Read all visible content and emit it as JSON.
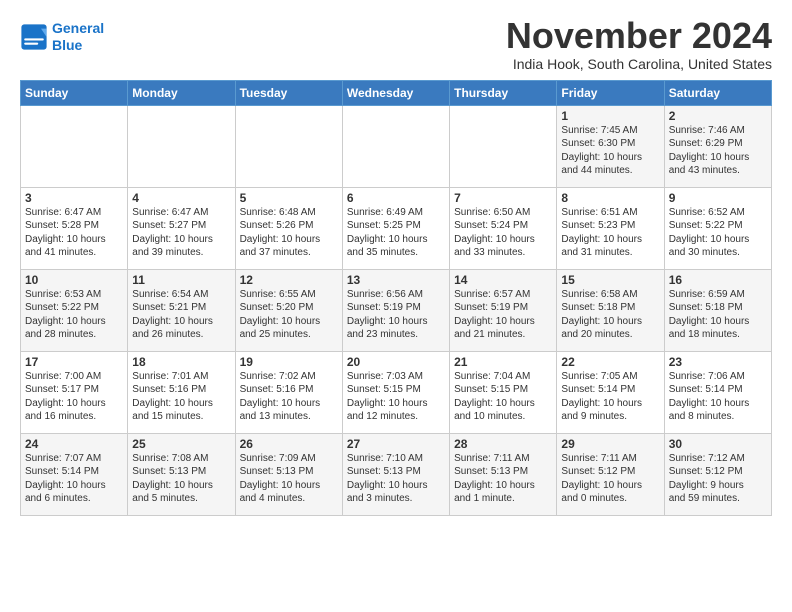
{
  "logo": {
    "line1": "General",
    "line2": "Blue"
  },
  "title": "November 2024",
  "subtitle": "India Hook, South Carolina, United States",
  "weekdays": [
    "Sunday",
    "Monday",
    "Tuesday",
    "Wednesday",
    "Thursday",
    "Friday",
    "Saturday"
  ],
  "weeks": [
    [
      {
        "day": "",
        "info": ""
      },
      {
        "day": "",
        "info": ""
      },
      {
        "day": "",
        "info": ""
      },
      {
        "day": "",
        "info": ""
      },
      {
        "day": "",
        "info": ""
      },
      {
        "day": "1",
        "info": "Sunrise: 7:45 AM\nSunset: 6:30 PM\nDaylight: 10 hours\nand 44 minutes."
      },
      {
        "day": "2",
        "info": "Sunrise: 7:46 AM\nSunset: 6:29 PM\nDaylight: 10 hours\nand 43 minutes."
      }
    ],
    [
      {
        "day": "3",
        "info": "Sunrise: 6:47 AM\nSunset: 5:28 PM\nDaylight: 10 hours\nand 41 minutes."
      },
      {
        "day": "4",
        "info": "Sunrise: 6:47 AM\nSunset: 5:27 PM\nDaylight: 10 hours\nand 39 minutes."
      },
      {
        "day": "5",
        "info": "Sunrise: 6:48 AM\nSunset: 5:26 PM\nDaylight: 10 hours\nand 37 minutes."
      },
      {
        "day": "6",
        "info": "Sunrise: 6:49 AM\nSunset: 5:25 PM\nDaylight: 10 hours\nand 35 minutes."
      },
      {
        "day": "7",
        "info": "Sunrise: 6:50 AM\nSunset: 5:24 PM\nDaylight: 10 hours\nand 33 minutes."
      },
      {
        "day": "8",
        "info": "Sunrise: 6:51 AM\nSunset: 5:23 PM\nDaylight: 10 hours\nand 31 minutes."
      },
      {
        "day": "9",
        "info": "Sunrise: 6:52 AM\nSunset: 5:22 PM\nDaylight: 10 hours\nand 30 minutes."
      }
    ],
    [
      {
        "day": "10",
        "info": "Sunrise: 6:53 AM\nSunset: 5:22 PM\nDaylight: 10 hours\nand 28 minutes."
      },
      {
        "day": "11",
        "info": "Sunrise: 6:54 AM\nSunset: 5:21 PM\nDaylight: 10 hours\nand 26 minutes."
      },
      {
        "day": "12",
        "info": "Sunrise: 6:55 AM\nSunset: 5:20 PM\nDaylight: 10 hours\nand 25 minutes."
      },
      {
        "day": "13",
        "info": "Sunrise: 6:56 AM\nSunset: 5:19 PM\nDaylight: 10 hours\nand 23 minutes."
      },
      {
        "day": "14",
        "info": "Sunrise: 6:57 AM\nSunset: 5:19 PM\nDaylight: 10 hours\nand 21 minutes."
      },
      {
        "day": "15",
        "info": "Sunrise: 6:58 AM\nSunset: 5:18 PM\nDaylight: 10 hours\nand 20 minutes."
      },
      {
        "day": "16",
        "info": "Sunrise: 6:59 AM\nSunset: 5:18 PM\nDaylight: 10 hours\nand 18 minutes."
      }
    ],
    [
      {
        "day": "17",
        "info": "Sunrise: 7:00 AM\nSunset: 5:17 PM\nDaylight: 10 hours\nand 16 minutes."
      },
      {
        "day": "18",
        "info": "Sunrise: 7:01 AM\nSunset: 5:16 PM\nDaylight: 10 hours\nand 15 minutes."
      },
      {
        "day": "19",
        "info": "Sunrise: 7:02 AM\nSunset: 5:16 PM\nDaylight: 10 hours\nand 13 minutes."
      },
      {
        "day": "20",
        "info": "Sunrise: 7:03 AM\nSunset: 5:15 PM\nDaylight: 10 hours\nand 12 minutes."
      },
      {
        "day": "21",
        "info": "Sunrise: 7:04 AM\nSunset: 5:15 PM\nDaylight: 10 hours\nand 10 minutes."
      },
      {
        "day": "22",
        "info": "Sunrise: 7:05 AM\nSunset: 5:14 PM\nDaylight: 10 hours\nand 9 minutes."
      },
      {
        "day": "23",
        "info": "Sunrise: 7:06 AM\nSunset: 5:14 PM\nDaylight: 10 hours\nand 8 minutes."
      }
    ],
    [
      {
        "day": "24",
        "info": "Sunrise: 7:07 AM\nSunset: 5:14 PM\nDaylight: 10 hours\nand 6 minutes."
      },
      {
        "day": "25",
        "info": "Sunrise: 7:08 AM\nSunset: 5:13 PM\nDaylight: 10 hours\nand 5 minutes."
      },
      {
        "day": "26",
        "info": "Sunrise: 7:09 AM\nSunset: 5:13 PM\nDaylight: 10 hours\nand 4 minutes."
      },
      {
        "day": "27",
        "info": "Sunrise: 7:10 AM\nSunset: 5:13 PM\nDaylight: 10 hours\nand 3 minutes."
      },
      {
        "day": "28",
        "info": "Sunrise: 7:11 AM\nSunset: 5:13 PM\nDaylight: 10 hours\nand 1 minute."
      },
      {
        "day": "29",
        "info": "Sunrise: 7:11 AM\nSunset: 5:12 PM\nDaylight: 10 hours\nand 0 minutes."
      },
      {
        "day": "30",
        "info": "Sunrise: 7:12 AM\nSunset: 5:12 PM\nDaylight: 9 hours\nand 59 minutes."
      }
    ]
  ]
}
